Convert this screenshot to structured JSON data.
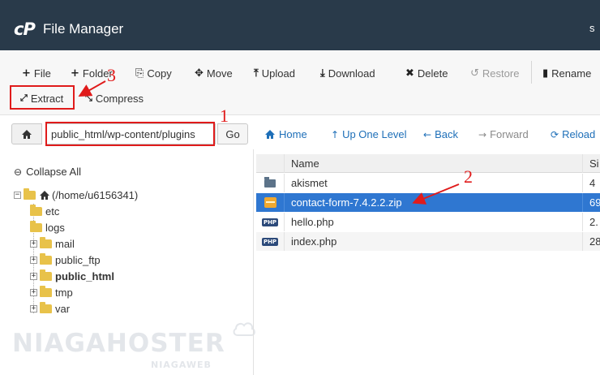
{
  "header": {
    "logo_text": "cP",
    "title": "File Manager",
    "truncated_right": "s"
  },
  "toolbar": {
    "file": "File",
    "folder": "Folder",
    "copy": "Copy",
    "move": "Move",
    "upload": "Upload",
    "download": "Download",
    "delete": "Delete",
    "restore": "Restore",
    "rename": "Rename",
    "extract": "Extract",
    "compress": "Compress"
  },
  "pathbar": {
    "path_value": "public_html/wp-content/plugins",
    "go": "Go"
  },
  "nav": {
    "home": "Home",
    "up_one_level": "Up One Level",
    "back": "Back",
    "forward": "Forward",
    "reload": "Reload"
  },
  "tree": {
    "collapse_all": "Collapse All",
    "root": "(/home/u6156341)",
    "items": [
      {
        "label": "etc"
      },
      {
        "label": "logs"
      },
      {
        "label": "mail"
      },
      {
        "label": "public_ftp"
      },
      {
        "label": "public_html"
      },
      {
        "label": "tmp"
      },
      {
        "label": "var"
      }
    ]
  },
  "files": {
    "col_name": "Name",
    "col_size": "Si",
    "rows": [
      {
        "name": "akismet",
        "size": "4",
        "icon": "folder-icon"
      },
      {
        "name": "contact-form-7.4.2.2.zip",
        "size": "69",
        "icon": "zip-archive-icon"
      },
      {
        "name": "hello.php",
        "size": "2.",
        "icon": "php-file-icon"
      },
      {
        "name": "index.php",
        "size": "28",
        "icon": "php-file-icon"
      }
    ]
  },
  "annotations": {
    "step1": "1",
    "step2": "2",
    "step3": "3"
  },
  "watermark": {
    "brand": "NIAGAHOSTER",
    "sub": "NIAGAWEB"
  },
  "colors": {
    "header_bg": "#293a4a",
    "selected_row": "#2f77d1",
    "annotation_red": "#e01b1b",
    "link_blue": "#1e6fb8"
  }
}
